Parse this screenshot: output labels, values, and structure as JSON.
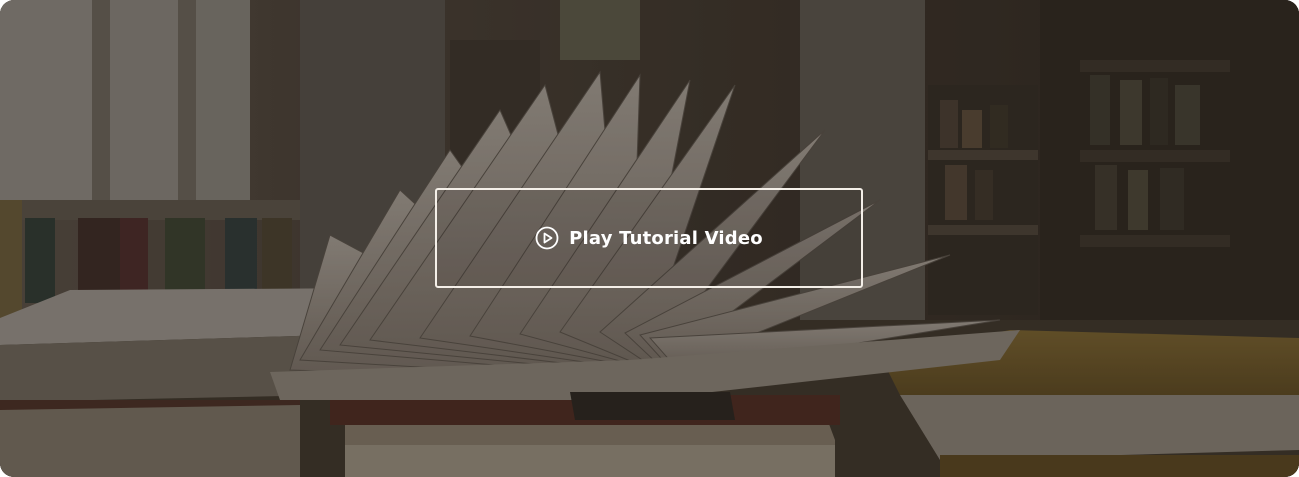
{
  "hero": {
    "background": "open-book-library-photo",
    "cta": {
      "label": "Play Tutorial Video",
      "icon": "play-circle-icon",
      "border_color": "#f4efe8"
    }
  }
}
